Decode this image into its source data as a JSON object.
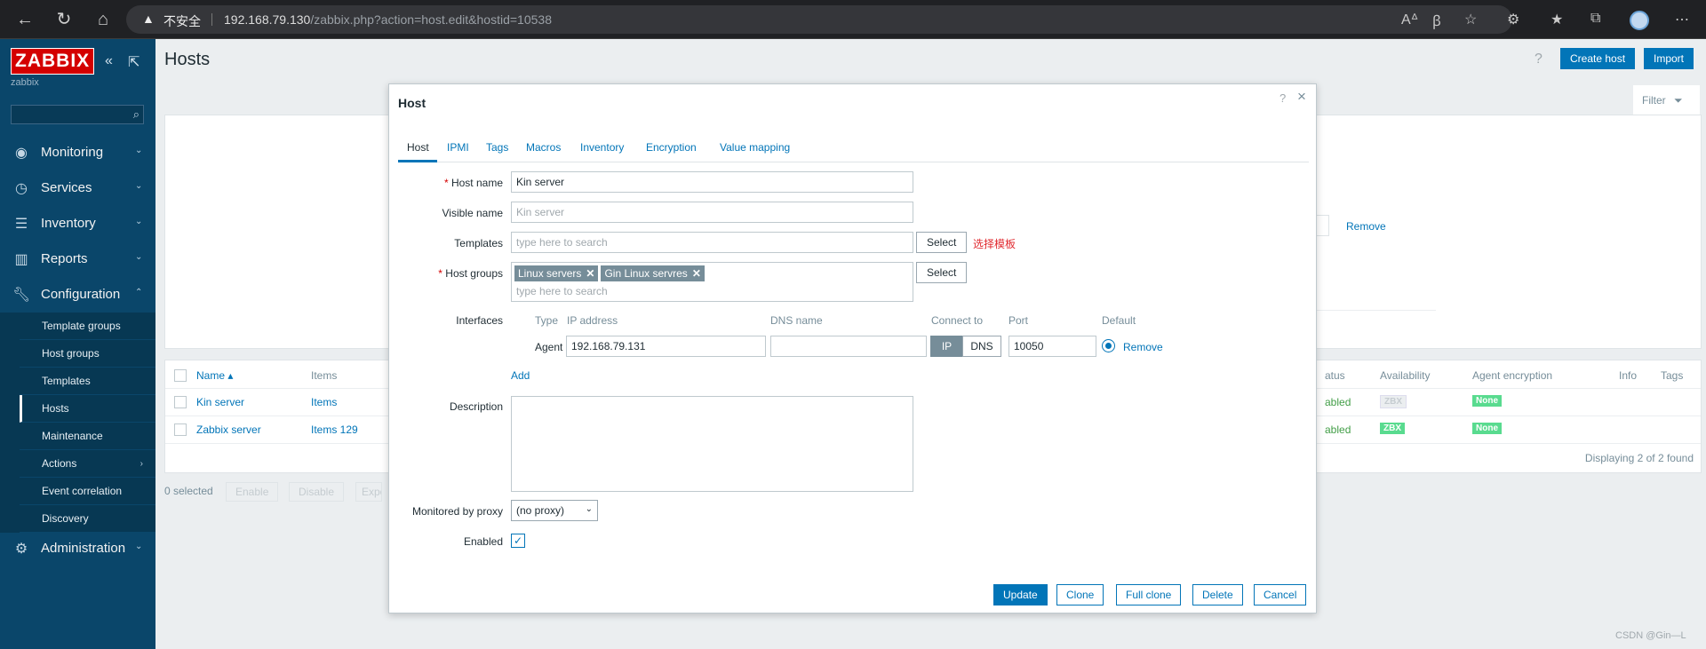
{
  "browser": {
    "insecure_label": "不安全",
    "url_host": "192.168.79.130",
    "url_path": "/zabbix.php?action=host.edit&hostid=10538"
  },
  "sidebar": {
    "logo": "ZABBIX",
    "server_name": "zabbix",
    "search_placeholder": "",
    "menu": [
      {
        "label": "Monitoring",
        "icon": "eye-icon"
      },
      {
        "label": "Services",
        "icon": "clock-icon"
      },
      {
        "label": "Inventory",
        "icon": "list-icon"
      },
      {
        "label": "Reports",
        "icon": "bar-chart-icon"
      },
      {
        "label": "Configuration",
        "icon": "wrench-icon"
      },
      {
        "label": "Administration",
        "icon": "gear-icon"
      }
    ],
    "config_items": [
      "Template groups",
      "Host groups",
      "Templates",
      "Hosts",
      "Maintenance",
      "Actions",
      "Event correlation",
      "Discovery"
    ]
  },
  "header": {
    "title": "Hosts",
    "create_host": "Create host",
    "import": "Import",
    "filter": "Filter"
  },
  "background": {
    "remove_link": "Remove",
    "columns": {
      "name": "Name ▴",
      "items": "Items",
      "status": "atus",
      "availability": "Availability",
      "agent_encryption": "Agent encryption",
      "info": "Info",
      "tags": "Tags"
    },
    "rows": [
      {
        "name": "Kin server",
        "items": "Items",
        "status": "abled",
        "zbx": "ZBX",
        "enc": "None"
      },
      {
        "name": "Zabbix server",
        "items": "Items 129",
        "status": "abled",
        "zbx": "ZBX",
        "enc": "None"
      }
    ],
    "displaying": "Displaying 2 of 2 found",
    "selected": "0 selected",
    "mass": {
      "enable": "Enable",
      "disable": "Disable",
      "export": "Expo"
    }
  },
  "modal": {
    "title": "Host",
    "help": "?",
    "tabs": [
      "Host",
      "IPMI",
      "Tags",
      "Macros",
      "Inventory",
      "Encryption",
      "Value mapping"
    ],
    "form": {
      "host_name_label": "Host name",
      "host_name_value": "Kin server",
      "visible_name_label": "Visible name",
      "visible_name_placeholder": "Kin server",
      "templates_label": "Templates",
      "templates_placeholder": "type here to search",
      "select_button": "Select",
      "templates_note": "选择模板",
      "host_groups_label": "Host groups",
      "host_groups": [
        "Linux servers",
        "Gin Linux servres"
      ],
      "host_groups_placeholder": "type here to search",
      "interfaces_label": "Interfaces",
      "iface_headers": {
        "type": "Type",
        "ip": "IP address",
        "dns": "DNS name",
        "connect": "Connect to",
        "port": "Port",
        "default": "Default"
      },
      "iface_type": "Agent",
      "iface_ip": "192.168.79.131",
      "iface_dns": "",
      "iface_connect_ip": "IP",
      "iface_connect_dns": "DNS",
      "iface_port": "10050",
      "iface_remove": "Remove",
      "add_link": "Add",
      "description_label": "Description",
      "description_value": "",
      "proxy_label": "Monitored by proxy",
      "proxy_value": "(no proxy)",
      "enabled_label": "Enabled",
      "enabled_checked": true
    },
    "buttons": {
      "update": "Update",
      "clone": "Clone",
      "full_clone": "Full clone",
      "delete": "Delete",
      "cancel": "Cancel"
    }
  },
  "watermark": "CSDN @Gin—L"
}
